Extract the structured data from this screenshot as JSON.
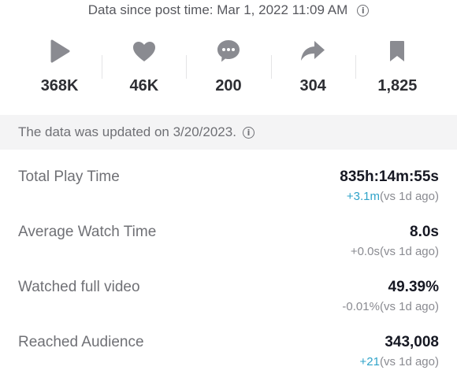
{
  "header": {
    "since_text": "Data since post time: Mar 1, 2022 11:09 AM"
  },
  "metrics": [
    {
      "icon": "play-icon",
      "value": "368K"
    },
    {
      "icon": "heart-icon",
      "value": "46K"
    },
    {
      "icon": "comment-icon",
      "value": "200"
    },
    {
      "icon": "share-icon",
      "value": "304"
    },
    {
      "icon": "bookmark-icon",
      "value": "1,825"
    }
  ],
  "update_notice": "The data was updated on 3/20/2023.",
  "stats": [
    {
      "label": "Total Play Time",
      "value": "835h:14m:55s",
      "delta": "+3.1m",
      "delta_suffix": "(vs 1d ago)"
    },
    {
      "label": "Average Watch Time",
      "value": "8.0s",
      "delta": "+0.0s",
      "delta_suffix": "(vs 1d ago)"
    },
    {
      "label": "Watched full video",
      "value": "49.39%",
      "delta": "-0.01%",
      "delta_suffix": "(vs 1d ago)"
    },
    {
      "label": "Reached Audience",
      "value": "343,008",
      "delta": "+21",
      "delta_suffix": "(vs 1d ago)"
    }
  ],
  "colors": {
    "icon_gray": "#8a8b91",
    "positive_delta": "#2fa3c9",
    "update_bar_bg": "#f4f4f5"
  }
}
